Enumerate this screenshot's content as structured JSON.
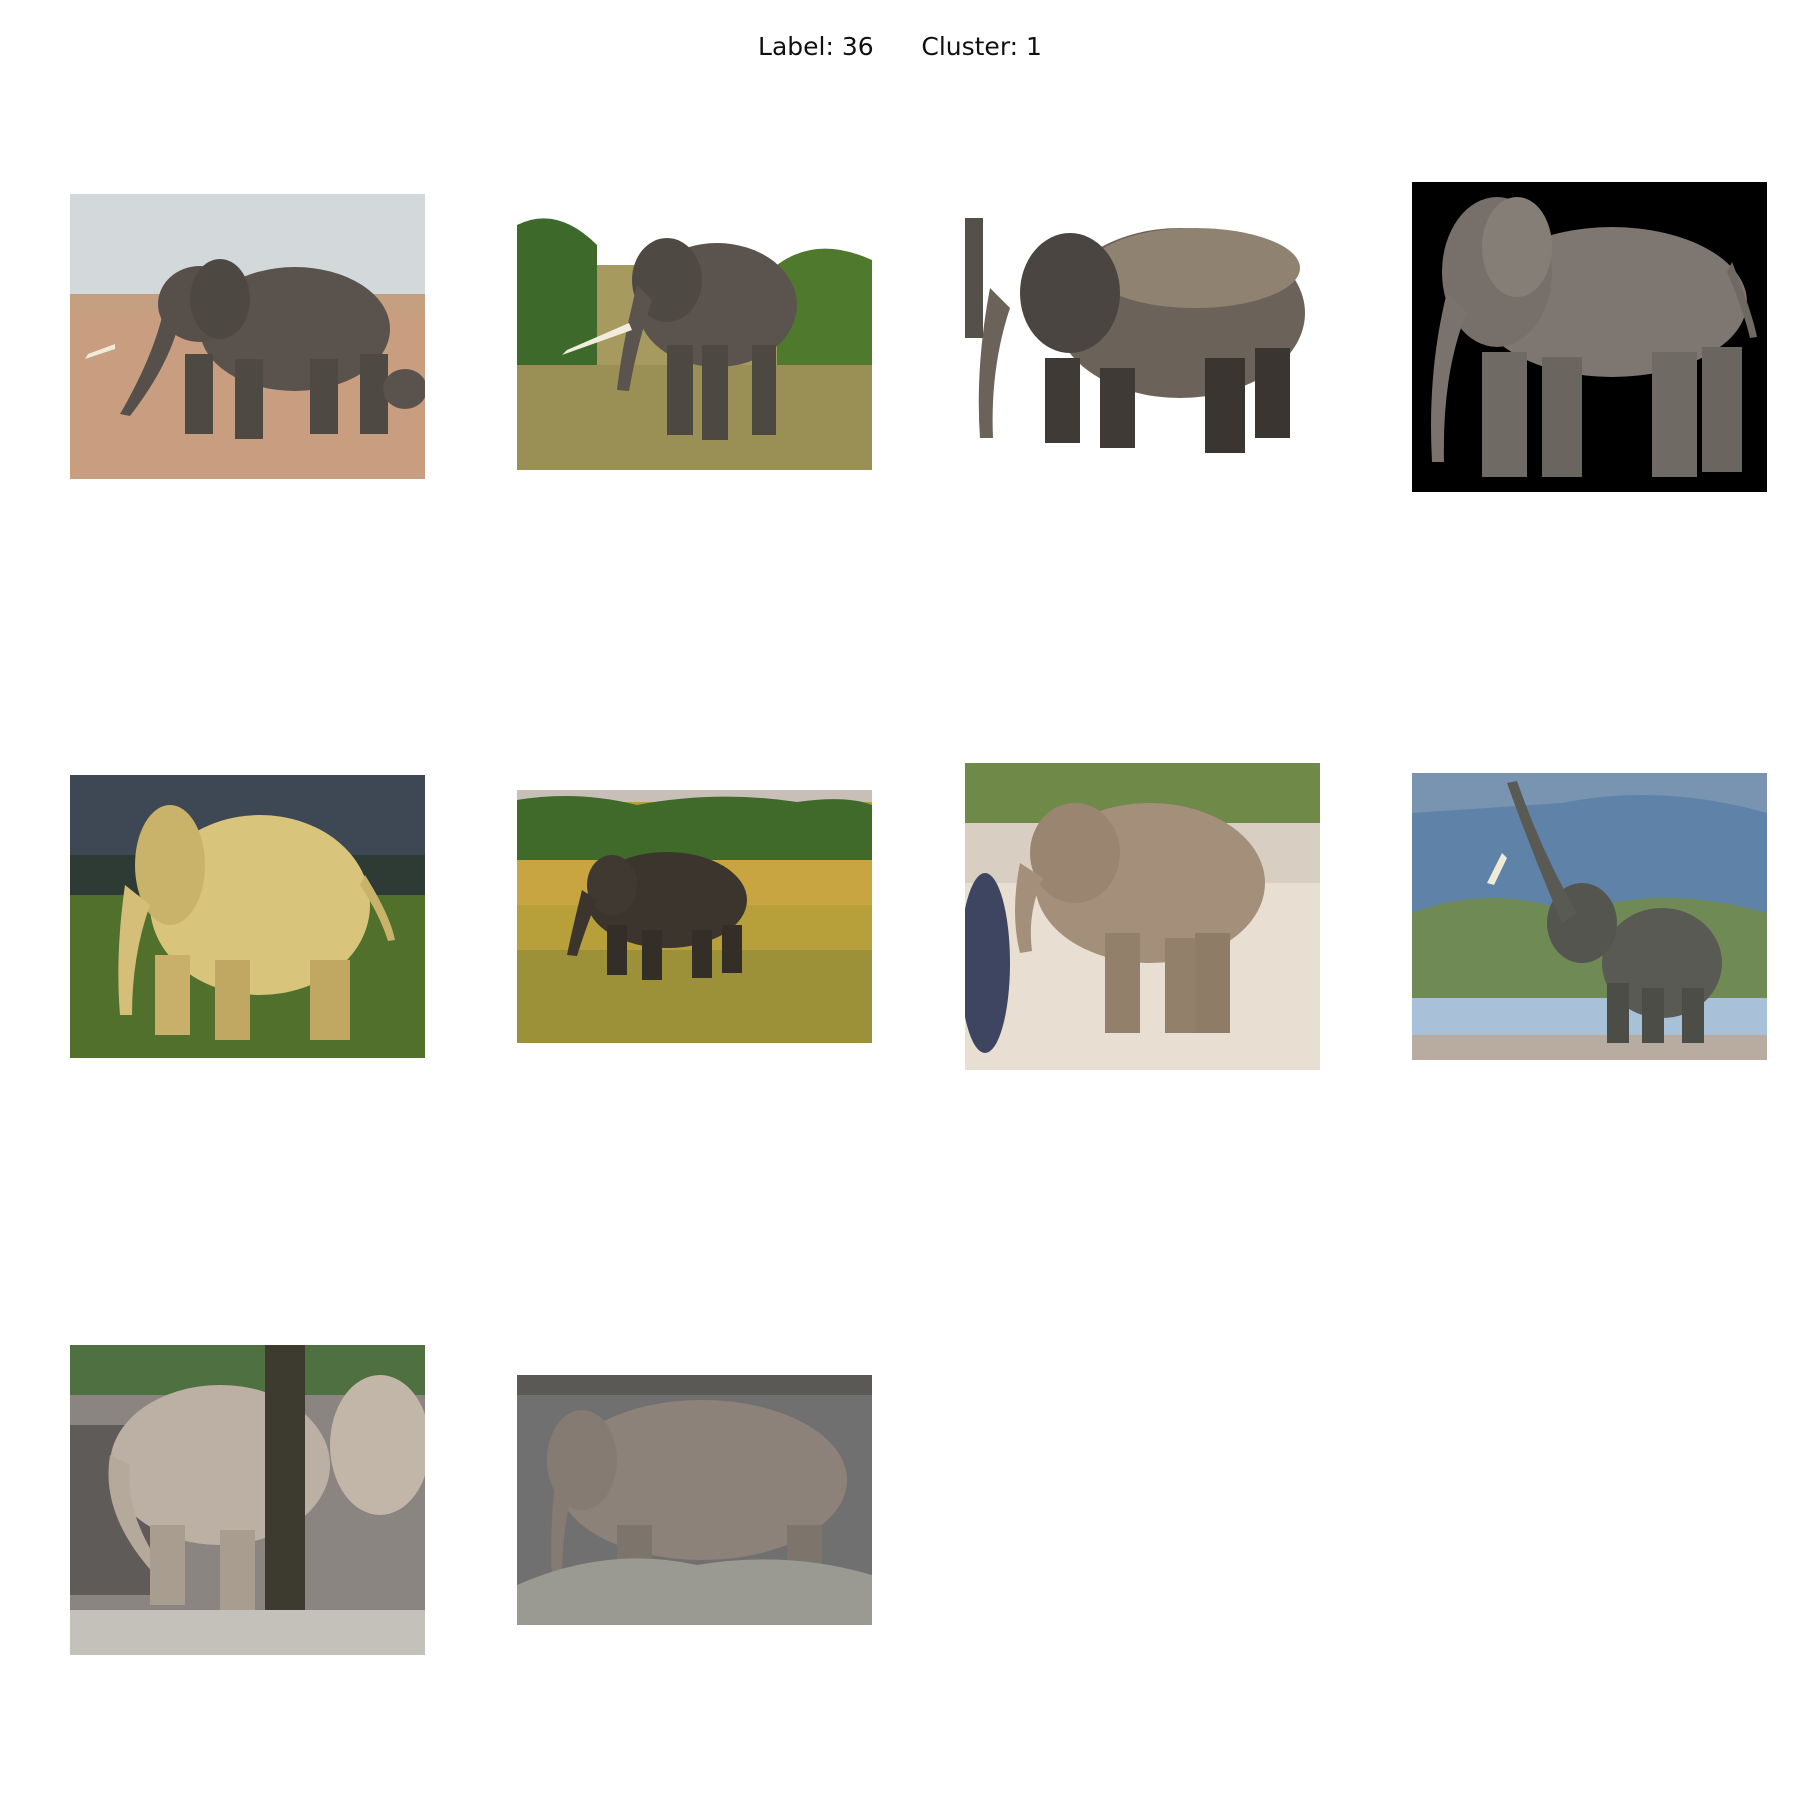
{
  "header": {
    "label_text": "Label: 36",
    "cluster_text": "Cluster: 1"
  },
  "images": [
    {
      "name": "elephant-savanna-walking",
      "bg": "#c79b7d",
      "sky": "#cfd5da",
      "body": "#5d5650"
    },
    {
      "name": "elephant-grass-trees",
      "bg": "#8f8a4e",
      "sky": "#ffffff",
      "body": "#5f5850"
    },
    {
      "name": "elephant-cutout-white",
      "bg": "#ffffff",
      "sky": "#ffffff",
      "body": "#4a4540"
    },
    {
      "name": "elephant-3d-render-black",
      "bg": "#000000",
      "sky": "#000000",
      "body": "#7d7670"
    },
    {
      "name": "elephant-golden-light",
      "bg": "#4d6a2a",
      "sky": "#3a4550",
      "body": "#d8c27a"
    },
    {
      "name": "elephant-yellow-field",
      "bg": "#b8a23a",
      "sky": "#5f7a3a",
      "body": "#3e3830"
    },
    {
      "name": "elephant-zoo-pavement",
      "bg": "#e6ddd0",
      "sky": "#6f8a48",
      "body": "#a38f74"
    },
    {
      "name": "elephant-raised-trunk-river",
      "bg": "#8da6bd",
      "sky": "#5f82a8",
      "body": "#5a5a55"
    },
    {
      "name": "elephant-zoo-tree",
      "bg": "#8a8580",
      "sky": "#4f7040",
      "body": "#b8aca0"
    },
    {
      "name": "elephant-rock-enclosure",
      "bg": "#8d8a85",
      "sky": "#6e6c68",
      "body": "#8a8078"
    }
  ]
}
